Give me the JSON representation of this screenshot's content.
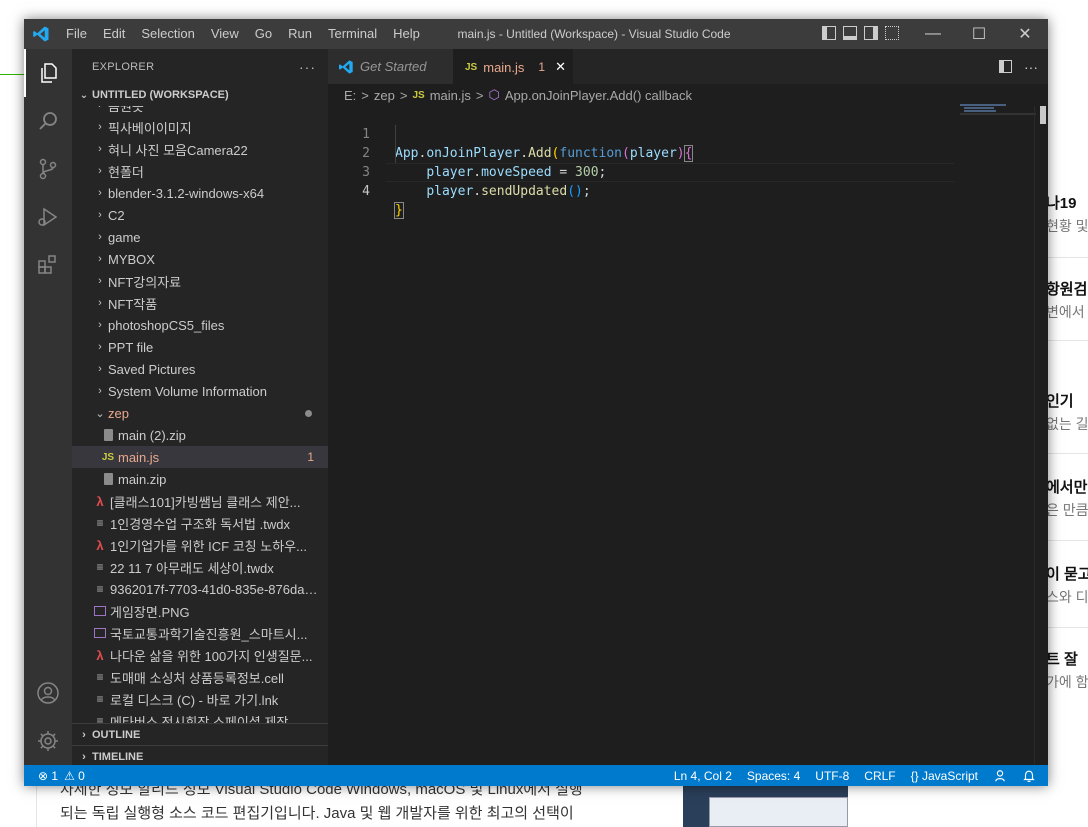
{
  "background": {
    "right_items": [
      {
        "title": "나19",
        "sub": "현황 및"
      },
      {
        "title": "항원검",
        "sub": "변에서"
      },
      {
        "title": "인기",
        "sub": "없는 길"
      },
      {
        "title": "에서만",
        "sub": "은 만큼"
      },
      {
        "title": "이 묻고",
        "sub": "스와 디"
      },
      {
        "title": "트 잘",
        "sub": "가에 함"
      }
    ],
    "bottom_text_1": "자세한 정보 알리드 정보 Visual Studio Code Windows, macOS 및 Linux에서 실행",
    "bottom_text_2": "되는 독립 실행형 소스 코드 편집기입니다. Java 및 웹 개발자를 위한 최고의 선택이"
  },
  "window": {
    "title": "main.js - Untitled (Workspace) - Visual Studio Code",
    "menu": [
      "File",
      "Edit",
      "Selection",
      "View",
      "Go",
      "Run",
      "Terminal",
      "Help"
    ],
    "minimize": "—",
    "maximize": "☐",
    "close": "✕"
  },
  "activity_bar": {
    "icons": [
      "files-icon",
      "search-icon",
      "source-control-icon",
      "run-debug-icon",
      "extensions-icon",
      "account-icon",
      "settings-gear-icon"
    ]
  },
  "sidebar": {
    "header": "EXPLORER",
    "more": "···",
    "workspace": "UNTITLED (WORKSPACE)",
    "items": [
      {
        "label": "음원듯",
        "type": "folder",
        "indent": 1
      },
      {
        "label": "픽사베이이미지",
        "type": "folder",
        "indent": 1
      },
      {
        "label": "혀니 사진 모음Camera22",
        "type": "folder",
        "indent": 1
      },
      {
        "label": "현폴더",
        "type": "folder",
        "indent": 1
      },
      {
        "label": "blender-3.1.2-windows-x64",
        "type": "folder",
        "indent": 1
      },
      {
        "label": "C2",
        "type": "folder",
        "indent": 1
      },
      {
        "label": "game",
        "type": "folder",
        "indent": 1
      },
      {
        "label": "MYBOX",
        "type": "folder",
        "indent": 1
      },
      {
        "label": "NFT강의자료",
        "type": "folder",
        "indent": 1
      },
      {
        "label": "NFT작품",
        "type": "folder",
        "indent": 1
      },
      {
        "label": "photoshopCS5_files",
        "type": "folder",
        "indent": 1
      },
      {
        "label": "PPT file",
        "type": "folder",
        "indent": 1
      },
      {
        "label": "Saved Pictures",
        "type": "folder",
        "indent": 1
      },
      {
        "label": "System Volume Information",
        "type": "folder",
        "indent": 1
      },
      {
        "label": "zep",
        "type": "folder-open",
        "indent": 1,
        "modified": true
      },
      {
        "label": "main (2).zip",
        "type": "zip",
        "indent": 2
      },
      {
        "label": "main.js",
        "type": "js",
        "indent": 2,
        "badge": "1",
        "selected": true
      },
      {
        "label": "main.zip",
        "type": "zip",
        "indent": 2
      },
      {
        "label": "[클래스101]카빙쌤님 클래스 제안...",
        "type": "pdf",
        "indent": 1
      },
      {
        "label": "1인경영수업  구조화 독서법 .twdx",
        "type": "text",
        "indent": 1
      },
      {
        "label": "1인기업가를 위한 ICF 코칭 노하우...",
        "type": "pdf",
        "indent": 1
      },
      {
        "label": "22 11 7 아무래도 세상이.twdx",
        "type": "text",
        "indent": 1
      },
      {
        "label": "9362017f-7703-41d0-835e-876da5...",
        "type": "text",
        "indent": 1
      },
      {
        "label": "게임장면.PNG",
        "type": "image",
        "indent": 1
      },
      {
        "label": "국토교통과학기술진흥원_스마트시...",
        "type": "image",
        "indent": 1
      },
      {
        "label": "나다운 삶을 위한 100가지 인생질문...",
        "type": "pdf",
        "indent": 1
      },
      {
        "label": "도매매 소싱처 상품등록정보.cell",
        "type": "text",
        "indent": 1
      },
      {
        "label": "로컬 디스크 (C) - 바로 가기.lnk",
        "type": "text",
        "indent": 1
      },
      {
        "label": "메타버스 전시회장 스페이셜 제작...",
        "type": "text",
        "indent": 1
      }
    ],
    "outline": "OUTLINE",
    "timeline": "TIMELINE"
  },
  "editor": {
    "tabs": [
      {
        "label": "Get Started",
        "icon": "vscode-logo-icon"
      },
      {
        "label": "main.js",
        "icon_text": "JS",
        "badge": "1",
        "close": "✕"
      }
    ],
    "breadcrumb": [
      "E:",
      ">",
      "zep",
      ">",
      "JS",
      "main.js",
      ">",
      "App.onJoinPlayer.Add() callback"
    ],
    "line_numbers": [
      "1",
      "2",
      "3",
      "4"
    ]
  },
  "statusbar": {
    "errors": "⊗ 1",
    "warnings": "⚠ 0",
    "position": "Ln 4, Col 2",
    "spaces": "Spaces: 4",
    "encoding": "UTF-8",
    "eol": "CRLF",
    "language": "{} JavaScript"
  },
  "colors": {
    "accent": "#007acc",
    "titlebar": "#3c3c3c",
    "sidebar": "#252526",
    "editor": "#1e1e1e"
  }
}
